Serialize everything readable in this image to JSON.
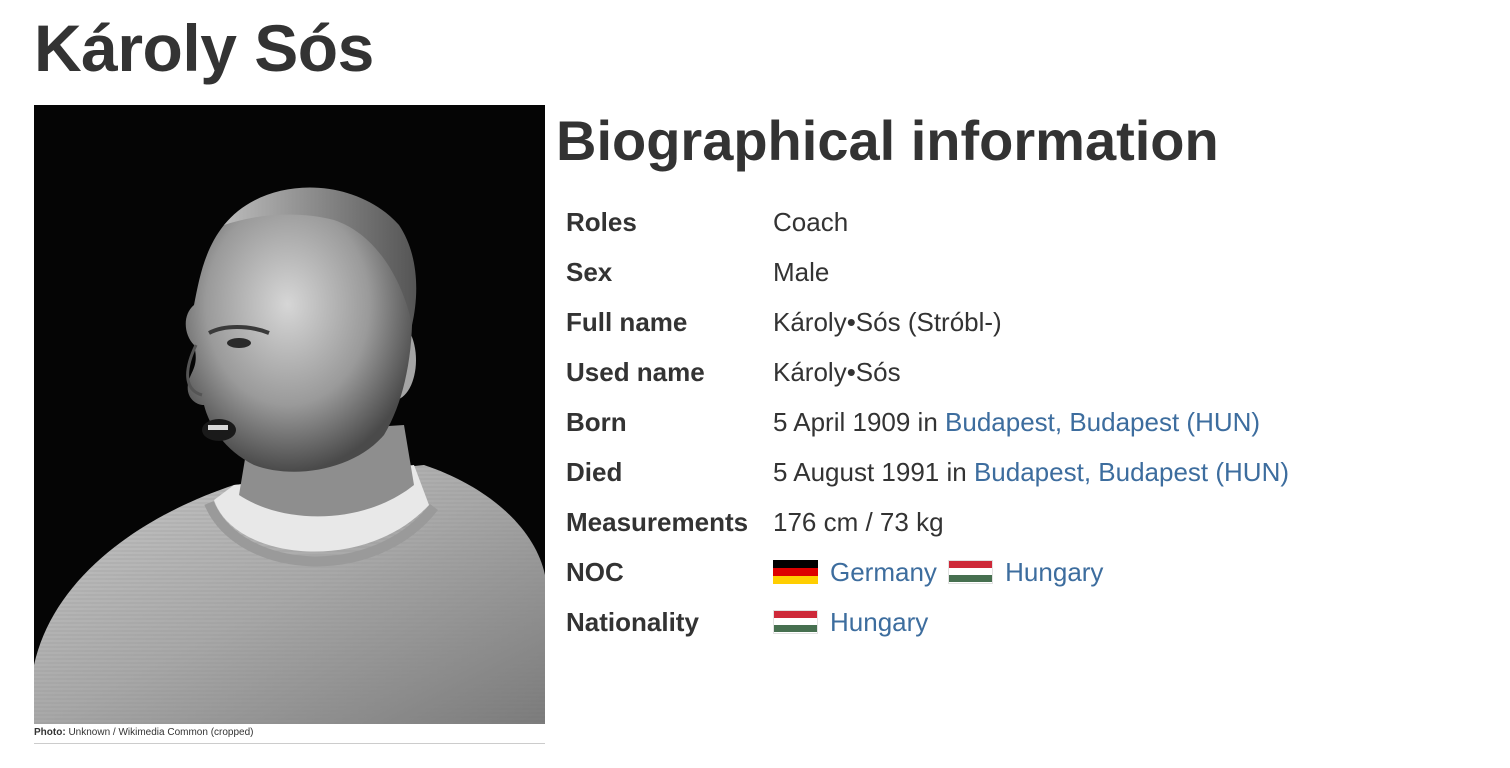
{
  "title": "Károly Sós",
  "photo": {
    "alt": "Portrait of Károly Sós",
    "credit_label": "Photo:",
    "credit_text": "Unknown / Wikimedia Common (cropped)"
  },
  "bio_heading": "Biographical information",
  "rows": {
    "roles": {
      "label": "Roles",
      "value": "Coach"
    },
    "sex": {
      "label": "Sex",
      "value": "Male"
    },
    "full_name": {
      "label": "Full name",
      "value": "Károly•Sós (Stróbl-)"
    },
    "used_name": {
      "label": "Used name",
      "value": "Károly•Sós"
    },
    "born": {
      "label": "Born",
      "date": "5 April 1909 in ",
      "place": "Budapest, Budapest (HUN)"
    },
    "died": {
      "label": "Died",
      "date": "5 August 1991 in ",
      "place": "Budapest, Budapest (HUN)"
    },
    "measurements": {
      "label": "Measurements",
      "value": "176 cm / 73 kg"
    },
    "noc": {
      "label": "NOC",
      "items": [
        {
          "name": "Germany",
          "flag_icon": "germany-flag-icon"
        },
        {
          "name": "Hungary",
          "flag_icon": "hungary-flag-icon"
        }
      ]
    },
    "nationality": {
      "label": "Nationality",
      "items": [
        {
          "name": "Hungary",
          "flag_icon": "hungary-flag-icon"
        }
      ]
    }
  },
  "colors": {
    "text": "#333333",
    "link": "#3d6d9e",
    "germany_flag": [
      "#000000",
      "#dd0000",
      "#ffce00"
    ],
    "hungary_flag": [
      "#ce2939",
      "#ffffff",
      "#477050"
    ]
  }
}
